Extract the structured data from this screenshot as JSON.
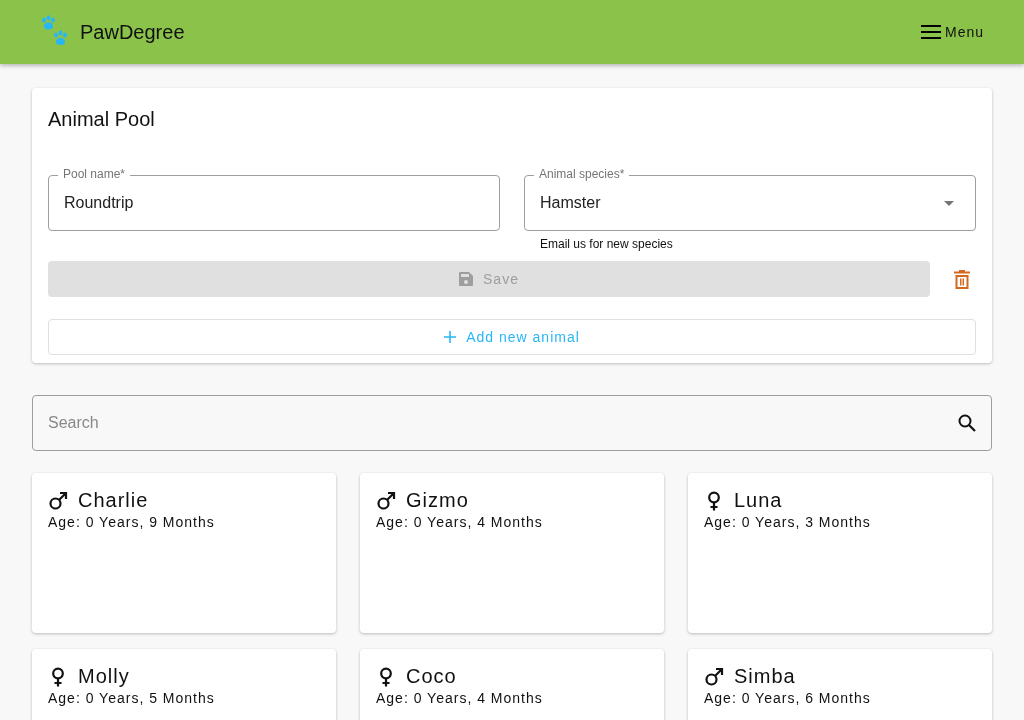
{
  "app_bar": {
    "brand": "PawDegree",
    "menu_label": "Menu"
  },
  "pool_form": {
    "title": "Animal Pool",
    "pool_name": {
      "label": "Pool name*",
      "value": "Roundtrip"
    },
    "species": {
      "label": "Animal species*",
      "value": "Hamster",
      "helper": "Email us for new species"
    },
    "save_button": {
      "label": "Save",
      "disabled": true
    },
    "add_button": {
      "label": "Add new animal"
    }
  },
  "search": {
    "placeholder": "Search"
  },
  "animals": [
    {
      "name": "Charlie",
      "kind": "male",
      "age": "Age: 0 Years, 9 Months"
    },
    {
      "name": "Gizmo",
      "kind": "male",
      "age": "Age: 0 Years, 4 Months"
    },
    {
      "name": "Luna",
      "kind": "female",
      "age": "Age: 0 Years, 3 Months"
    },
    {
      "name": "Molly",
      "kind": "female",
      "age": "Age: 0 Years, 5 Months"
    },
    {
      "name": "Coco",
      "kind": "female",
      "age": "Age: 0 Years, 4 Months"
    },
    {
      "name": "Simba",
      "kind": "male",
      "age": "Age: 0 Years, 6 Months"
    }
  ]
}
